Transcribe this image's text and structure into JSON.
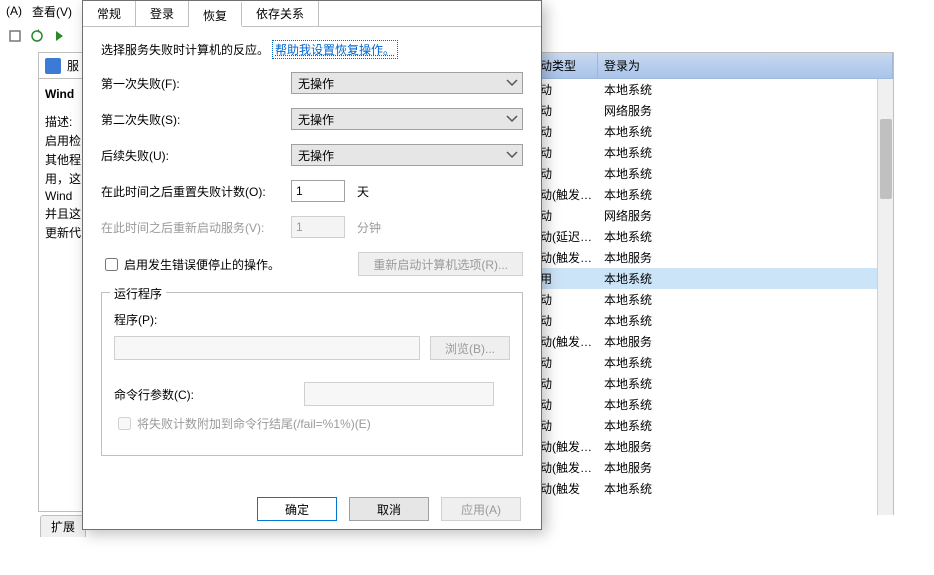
{
  "menu": {
    "a": "(A)",
    "view": "查看(V)"
  },
  "tabs_main": {
    "general": "常规",
    "login": "登录",
    "recovery": "恢复",
    "deps": "依存关系"
  },
  "intro": {
    "text": "选择服务失败时计算机的反应。",
    "link": "帮助我设置恢复操作。"
  },
  "fields": {
    "first": "第一次失败(F):",
    "second": "第二次失败(S):",
    "subsequent": "后续失败(U):",
    "reset_after": "在此时间之后重置失败计数(O):",
    "restart_after": "在此时间之后重新启动服务(V):"
  },
  "select_value": "无操作",
  "reset_value": "1",
  "reset_unit": "天",
  "restart_value": "1",
  "restart_unit": "分钟",
  "checkbox_stop": "启用发生错误便停止的操作。",
  "btn_restart_opts": "重新启动计算机选项(R)...",
  "group": {
    "legend": "运行程序",
    "program": "程序(P):",
    "browse": "浏览(B)...",
    "args": "命令行参数(C):",
    "append": "将失败计数附加到命令行结尾(/fail=%1%)(E)"
  },
  "footer": {
    "ok": "确定",
    "cancel": "取消",
    "apply": "应用(A)"
  },
  "left": {
    "head": "服",
    "name": "Wind",
    "lines": [
      "描述:",
      "启用检",
      "其他程",
      "用，这",
      "Wind",
      "并且这",
      "更新代"
    ],
    "tab": "扩展"
  },
  "list": {
    "col1": "动类型",
    "col2": "登录为",
    "rows": [
      {
        "a": "动",
        "b": "本地系统"
      },
      {
        "a": "动",
        "b": "网络服务"
      },
      {
        "a": "动",
        "b": "本地系统"
      },
      {
        "a": "动",
        "b": "本地系统"
      },
      {
        "a": "动",
        "b": "本地系统"
      },
      {
        "a": "动(触发…",
        "b": "本地系统"
      },
      {
        "a": "动",
        "b": "网络服务"
      },
      {
        "a": "动(延迟…",
        "b": "本地系统"
      },
      {
        "a": "动(触发…",
        "b": "本地服务"
      },
      {
        "a": "用",
        "b": "本地系统",
        "sel": true
      },
      {
        "a": "动",
        "b": "本地系统"
      },
      {
        "a": "动",
        "b": "本地系统"
      },
      {
        "a": "动(触发…",
        "b": "本地服务"
      },
      {
        "a": "动",
        "b": "本地系统"
      },
      {
        "a": "动",
        "b": "本地系统"
      },
      {
        "a": "动",
        "b": "本地系统"
      },
      {
        "a": "动",
        "b": "本地系统"
      },
      {
        "a": "动(触发…",
        "b": "本地服务"
      },
      {
        "a": "动(触发…",
        "b": "本地服务"
      },
      {
        "a": "动(触发",
        "b": "本地系统"
      }
    ]
  }
}
